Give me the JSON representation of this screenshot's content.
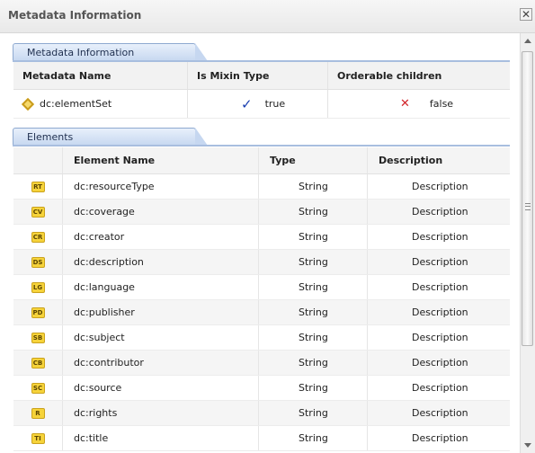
{
  "window": {
    "title": "Metadata Information",
    "close_glyph": "✕"
  },
  "metadata_section": {
    "tab_label": "Metadata Information",
    "columns": [
      "Metadata Name",
      "Is Mixin Type",
      "Orderable children"
    ],
    "row": {
      "icon": "diamond-icon",
      "name": "dc:elementSet",
      "mixin_value": "true",
      "mixin_icon": "checkmark-icon",
      "orderable_value": "false",
      "orderable_icon": "cross-icon"
    }
  },
  "elements_section": {
    "tab_label": "Elements",
    "columns": [
      "",
      "Element Name",
      "Type",
      "Description"
    ],
    "rows": [
      {
        "badge": "RT",
        "name": "dc:resourceType",
        "type": "String",
        "description": "Description"
      },
      {
        "badge": "CV",
        "name": "dc:coverage",
        "type": "String",
        "description": "Description"
      },
      {
        "badge": "CR",
        "name": "dc:creator",
        "type": "String",
        "description": "Description"
      },
      {
        "badge": "DS",
        "name": "dc:description",
        "type": "String",
        "description": "Description"
      },
      {
        "badge": "LG",
        "name": "dc:language",
        "type": "String",
        "description": "Description"
      },
      {
        "badge": "PD",
        "name": "dc:publisher",
        "type": "String",
        "description": "Description"
      },
      {
        "badge": "SB",
        "name": "dc:subject",
        "type": "String",
        "description": "Description"
      },
      {
        "badge": "CB",
        "name": "dc:contributor",
        "type": "String",
        "description": "Description"
      },
      {
        "badge": "SC",
        "name": "dc:source",
        "type": "String",
        "description": "Description"
      },
      {
        "badge": "R",
        "name": "dc:rights",
        "type": "String",
        "description": "Description"
      },
      {
        "badge": "TI",
        "name": "dc:title",
        "type": "String",
        "description": "Description"
      }
    ]
  },
  "colors": {
    "section_tab": "#c6d7f0",
    "badge": "#f6d33a",
    "check": "#1a3fb0",
    "cross": "#d2252b"
  }
}
